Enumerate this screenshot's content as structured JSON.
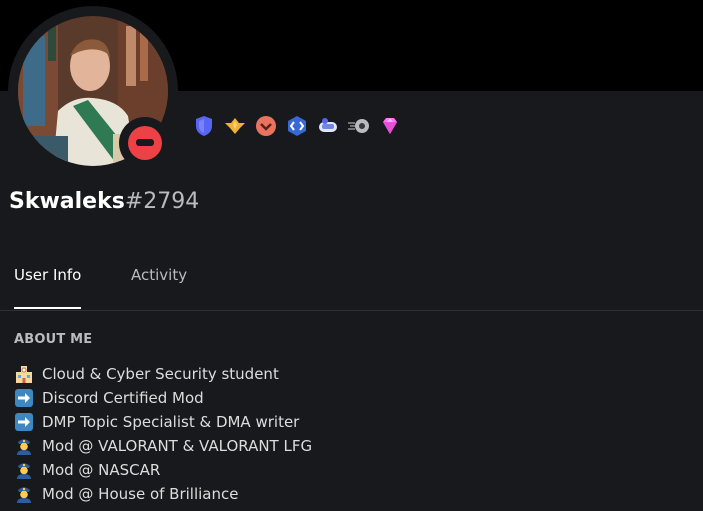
{
  "profile": {
    "username": "Skwaleks",
    "discriminator": "#2794",
    "status": "do-not-disturb",
    "status_color": "#ed4245"
  },
  "badges": [
    {
      "name": "moderator-programs-alumni-badge",
      "color": "#5865f2"
    },
    {
      "name": "hypesquad-bravery-badge",
      "color": "#f0b232"
    },
    {
      "name": "bug-hunter-badge",
      "color": "#e8735f"
    },
    {
      "name": "active-developer-badge",
      "color": "#3ba55d"
    },
    {
      "name": "early-supporter-badge",
      "color": "#7289da"
    },
    {
      "name": "nitro-boost-badge",
      "color": "#b9bbbe"
    },
    {
      "name": "server-boost-gem-badge",
      "color": "#ff73fa"
    }
  ],
  "tabs": [
    {
      "label": "User Info",
      "active": true
    },
    {
      "label": "Activity",
      "active": false
    }
  ],
  "about_me": {
    "title": "ABOUT ME",
    "items": [
      {
        "emoji": "school-emoji",
        "text": "Cloud & Cyber Security student"
      },
      {
        "emoji": "arrow-right-emoji",
        "text": "Discord Certified Mod"
      },
      {
        "emoji": "arrow-right-emoji",
        "text": "DMP Topic Specialist & DMA writer"
      },
      {
        "emoji": "police-officer-emoji",
        "text": "Mod @ VALORANT & VALORANT LFG"
      },
      {
        "emoji": "police-officer-emoji",
        "text": "Mod @ NASCAR"
      },
      {
        "emoji": "police-officer-emoji",
        "text": "Mod @ House of Brilliance"
      }
    ]
  },
  "colors": {
    "background": "#18191c",
    "banner": "#000000",
    "text_primary": "#ffffff",
    "text_muted": "#b9bbbe"
  }
}
